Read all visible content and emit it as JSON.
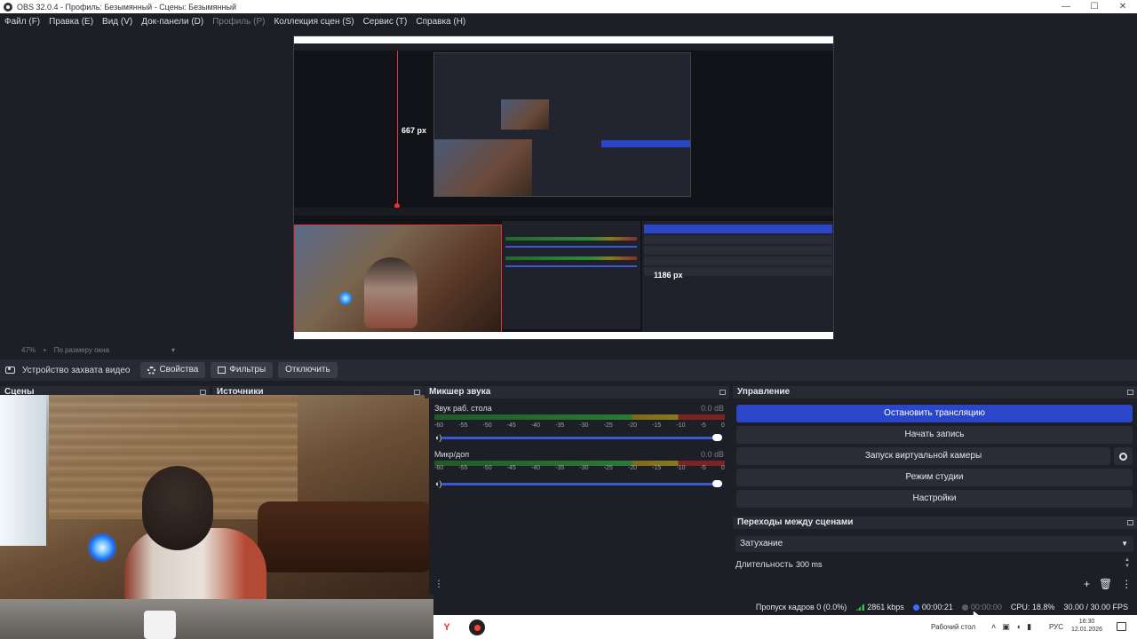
{
  "window": {
    "title": "OBS 32.0.4 - Профиль: Безымянный - Сцены: Безымянный",
    "min": "—",
    "max": "☐",
    "close": "✕"
  },
  "menu": [
    {
      "label": "Файл (F)",
      "disabled": false
    },
    {
      "label": "Правка (E)",
      "disabled": false
    },
    {
      "label": "Вид (V)",
      "disabled": false
    },
    {
      "label": "Док-панели (D)",
      "disabled": false
    },
    {
      "label": "Профиль (P)",
      "disabled": true
    },
    {
      "label": "Коллекция сцен (S)",
      "disabled": false
    },
    {
      "label": "Сервис (T)",
      "disabled": false
    },
    {
      "label": "Справка (H)",
      "disabled": false
    }
  ],
  "preview": {
    "height_label": "667 px",
    "width_label": "1186 px"
  },
  "zoom": {
    "percent": "47%",
    "fit_label": "По размеру окна"
  },
  "source_toolbar": {
    "source_name": "Устройство захвата видео",
    "properties": "Свойства",
    "filters": "Фильтры",
    "disconnect": "Отключить"
  },
  "docks": {
    "scenes": "Сцены",
    "sources": "Источники",
    "mixer": "Микшер звука",
    "controls": "Управление",
    "transitions": "Переходы между сценами"
  },
  "mixer": {
    "channels": [
      {
        "name": "Звук раб. стола",
        "db": "0.0 dB"
      },
      {
        "name": "Микр/доп",
        "db": "0.0 dB"
      }
    ],
    "scale": [
      "-60",
      "-55",
      "-50",
      "-45",
      "-40",
      "-35",
      "-30",
      "-25",
      "-20",
      "-15",
      "-10",
      "-5",
      "0"
    ]
  },
  "controls": {
    "stop_stream": "Остановить трансляцию",
    "start_record": "Начать запись",
    "virtual_cam": "Запуск виртуальной камеры",
    "studio_mode": "Режим студии",
    "settings": "Настройки"
  },
  "transitions": {
    "selected": "Затухание",
    "duration_label": "Длительность",
    "duration_value": "300 ms"
  },
  "status": {
    "dropped": "Пропуск кадров 0 (0.0%)",
    "bitrate": "2861 kbps",
    "stream_time": "00:00:21",
    "record_time": "00:00:00",
    "cpu": "CPU: 18.8%",
    "fps": "30.00 / 30.00 FPS"
  },
  "taskbar": {
    "yandex_icon": "Y",
    "desktop": "Рабочий стол",
    "lang": "РУС",
    "time": "16:30",
    "date": "12.01.2026"
  },
  "colors": {
    "accent": "#2b46c8",
    "background": "#1d1f26",
    "selection_red": "#e8303a"
  }
}
